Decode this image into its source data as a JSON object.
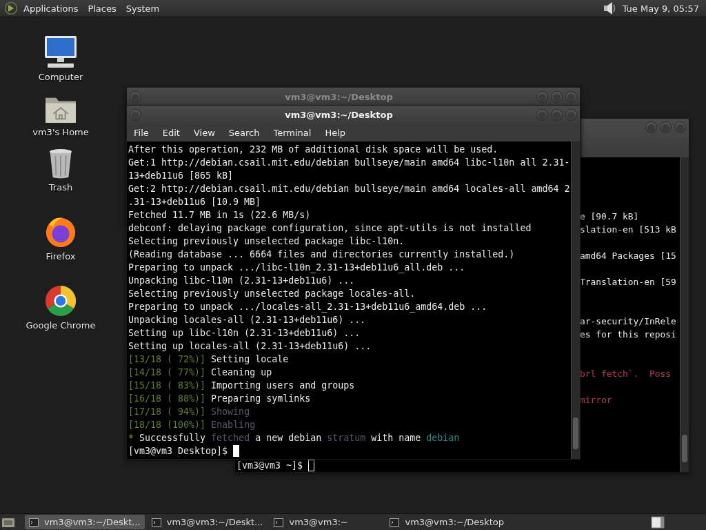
{
  "top_panel": {
    "menus": [
      "Applications",
      "Places",
      "System"
    ],
    "clock": "Tue May 9, 05:57"
  },
  "desktop_icons": [
    {
      "kind": "computer",
      "label": "Computer"
    },
    {
      "kind": "home",
      "label": "vm3's Home"
    },
    {
      "kind": "trash",
      "label": "Trash"
    },
    {
      "kind": "firefox",
      "label": "Firefox"
    },
    {
      "kind": "chrome",
      "label": "Google Chrome"
    }
  ],
  "back_terminal": {
    "lines": [
      {
        "kind": "blank"
      },
      {
        "kind": "blank"
      },
      {
        "kind": "blank"
      },
      {
        "kind": "blank"
      },
      {
        "kind": "text",
        "text": "e [90.7 kB]",
        "color": "#e8e8e8"
      },
      {
        "kind": "text",
        "text": "slation-en [513 kB",
        "color": "#e8e8e8"
      },
      {
        "kind": "blank"
      },
      {
        "kind": "text",
        "text": "amd64 Packages [15",
        "color": "#e8e8e8"
      },
      {
        "kind": "blank"
      },
      {
        "kind": "text",
        "text": "Translation-en [59",
        "color": "#e8e8e8"
      },
      {
        "kind": "blank"
      },
      {
        "kind": "blank"
      },
      {
        "kind": "text",
        "text": "ar-security/InRele",
        "color": "#e8e8e8"
      },
      {
        "kind": "text",
        "text": "es for this reposi",
        "color": "#e8e8e8"
      },
      {
        "kind": "blank"
      },
      {
        "kind": "blank"
      },
      {
        "kind": "text",
        "text": "brl fetch`.  Poss",
        "color": "#b8364e"
      },
      {
        "kind": "blank"
      },
      {
        "kind": "text",
        "text": "mirror",
        "color": "#b8364e"
      }
    ],
    "prompt": "[vm3@vm3 ~]$"
  },
  "middle_window": {
    "title": "vm3@vm3:~/Desktop"
  },
  "main_terminal": {
    "title": "vm3@vm3:~/Desktop",
    "menu": [
      "File",
      "Edit",
      "View",
      "Search",
      "Terminal",
      "Help"
    ],
    "lines": [
      [
        {
          "text": "After this operation, 232 MB of additional disk space will be used.",
          "color": "#e8e8e8"
        }
      ],
      [
        {
          "text": "Get:1 http://debian.csail.mit.edu/debian bullseye/main amd64 libc-l10n all 2.31-",
          "color": "#e8e8e8"
        }
      ],
      [
        {
          "text": "13+deb11u6 [865 kB]",
          "color": "#e8e8e8"
        }
      ],
      [
        {
          "text": "Get:2 http://debian.csail.mit.edu/debian bullseye/main amd64 locales-all amd64 2",
          "color": "#e8e8e8"
        }
      ],
      [
        {
          "text": ".31-13+deb11u6 [10.9 MB]",
          "color": "#e8e8e8"
        }
      ],
      [
        {
          "text": "Fetched 11.7 MB in 1s (22.6 MB/s)",
          "color": "#e8e8e8"
        }
      ],
      [
        {
          "text": "debconf: delaying package configuration, since apt-utils is not installed",
          "color": "#e8e8e8"
        }
      ],
      [
        {
          "text": "Selecting previously unselected package libc-l10n.",
          "color": "#e8e8e8"
        }
      ],
      [
        {
          "text": "(Reading database ... 6664 files and directories currently installed.)",
          "color": "#e8e8e8"
        }
      ],
      [
        {
          "text": "Preparing to unpack .../libc-l10n_2.31-13+deb11u6_all.deb ...",
          "color": "#e8e8e8"
        }
      ],
      [
        {
          "text": "Unpacking libc-l10n (2.31-13+deb11u6) ...",
          "color": "#e8e8e8"
        }
      ],
      [
        {
          "text": "Selecting previously unselected package locales-all.",
          "color": "#e8e8e8"
        }
      ],
      [
        {
          "text": "Preparing to unpack .../locales-all_2.31-13+deb11u6_amd64.deb ...",
          "color": "#e8e8e8"
        }
      ],
      [
        {
          "text": "Unpacking locales-all (2.31-13+deb11u6) ...",
          "color": "#e8e8e8"
        }
      ],
      [
        {
          "text": "Setting up libc-l10n (2.31-13+deb11u6) ...",
          "color": "#e8e8e8"
        }
      ],
      [
        {
          "text": "Setting up locales-all (2.31-13+deb11u6) ...",
          "color": "#e8e8e8"
        }
      ],
      [
        {
          "text": "[13/18 ( 72%)] ",
          "color": "#5b7f2e"
        },
        {
          "text": "Setting locale",
          "color": "#e8e8e8"
        }
      ],
      [
        {
          "text": "[14/18 ( 77%)] ",
          "color": "#5b7f2e"
        },
        {
          "text": "Cleaning up",
          "color": "#e8e8e8"
        }
      ],
      [
        {
          "text": "[15/18 ( 83%)] ",
          "color": "#5b7f2e"
        },
        {
          "text": "Importing users and groups",
          "color": "#e8e8e8"
        }
      ],
      [
        {
          "text": "[16/18 ( 88%)] ",
          "color": "#5b7f2e"
        },
        {
          "text": "Preparing symlinks",
          "color": "#e8e8e8"
        }
      ],
      [
        {
          "text": "[17/18 ( 94%)] ",
          "color": "#5b7f2e"
        },
        {
          "text": "Showing",
          "color": "#5e5566"
        }
      ],
      [
        {
          "text": "[18/18 (100%)] ",
          "color": "#5b7f2e"
        },
        {
          "text": "Enabling",
          "color": "#5e5566"
        }
      ],
      [
        {
          "text": "* ",
          "color": "#5b7f2e",
          "kind": "bullet"
        },
        {
          "text": "Successfully ",
          "color": "#e8e8e8"
        },
        {
          "text": "fetched",
          "color": "#5e5566"
        },
        {
          "text": " a new debian ",
          "color": "#e8e8e8"
        },
        {
          "text": "stratum",
          "color": "#5e5566"
        },
        {
          "text": " with name ",
          "color": "#e8e8e8"
        },
        {
          "text": "debian",
          "color": "#2e8b87"
        }
      ]
    ],
    "prompt": "[vm3@vm3 Desktop]$"
  },
  "taskbar": {
    "tasks": [
      {
        "label": "vm3@vm3:~/Deskt...",
        "selected": true
      },
      {
        "label": "vm3@vm3:~/Deskt...",
        "selected": false
      },
      {
        "label": "vm3@vm3:~",
        "selected": false
      },
      {
        "label": "vm3@vm3:~/Desktop",
        "selected": false
      }
    ]
  }
}
